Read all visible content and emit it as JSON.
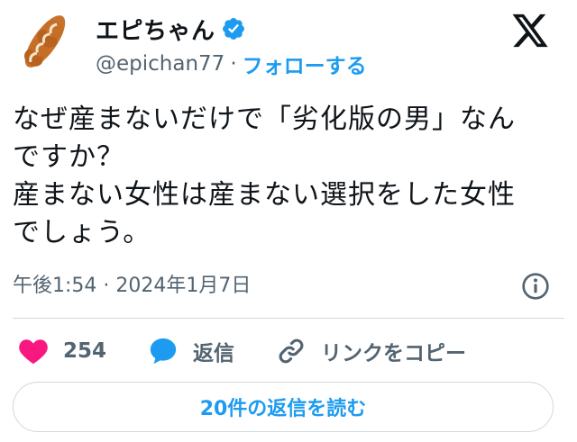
{
  "author": {
    "display_name": "エピちゃん",
    "handle": "@epichan77",
    "separator": "·",
    "follow_label": "フォローする",
    "verified": true
  },
  "tweet": {
    "text": "なぜ産まないだけで「劣化版の男」なん\nですか？\n産まない女性は産まない選択をした女性\nでしょう。",
    "timestamp": "午後1:54 · 2024年1月7日"
  },
  "actions": {
    "like_count": "254",
    "reply_label": "返信",
    "copy_link_label": "リンクをコピー"
  },
  "replies_button": {
    "label": "20件の返信を読む"
  },
  "colors": {
    "accent": "#1d9bf0",
    "like": "#f91880",
    "text": "#0f1419",
    "muted": "#536471",
    "border": "#cfd9de"
  },
  "icons": {
    "logo": "x-logo-icon",
    "verified": "verified-badge-icon",
    "info": "info-icon",
    "like": "heart-icon",
    "reply": "speech-bubble-icon",
    "copy": "link-icon"
  }
}
